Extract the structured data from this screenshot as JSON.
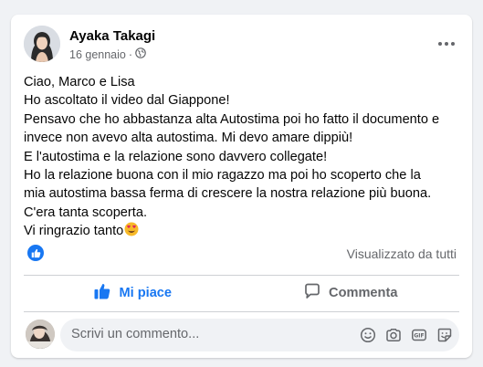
{
  "post": {
    "author": "Ayaka Takagi",
    "date": "16 gennaio",
    "separator": "·",
    "privacy_icon": "globe-icon",
    "lines": [
      "Ciao, Marco e Lisa",
      "Ho ascoltato il video dal Giappone!",
      "Pensavo che ho abbastanza alta Autostima poi ho fatto il documento e",
      "invece non avevo alta autostima. Mi devo amare dippiù!",
      "E l'autostima e la relazione sono davvero collegate!",
      "Ho la relazione buona con il mio ragazzo ma poi ho scoperto che la",
      "mia autostima bassa ferma di crescere la nostra relazione più buona.",
      "C'era tanta scoperta.",
      "Vi ringrazio tanto"
    ],
    "ending_emoji": "heart-eyes-emoji"
  },
  "reactions": {
    "icon": "like-icon",
    "seen_label": "Visualizzato da tutti"
  },
  "actions": {
    "like_label": "Mi piace",
    "comment_label": "Commenta"
  },
  "comment_box": {
    "placeholder": "Scrivi un commento...",
    "icons": [
      "emoji-icon",
      "camera-icon",
      "gif-icon",
      "sticker-icon"
    ]
  },
  "colors": {
    "accent": "#1877f2",
    "secondary_text": "#65676b",
    "background": "#f0f2f5"
  }
}
